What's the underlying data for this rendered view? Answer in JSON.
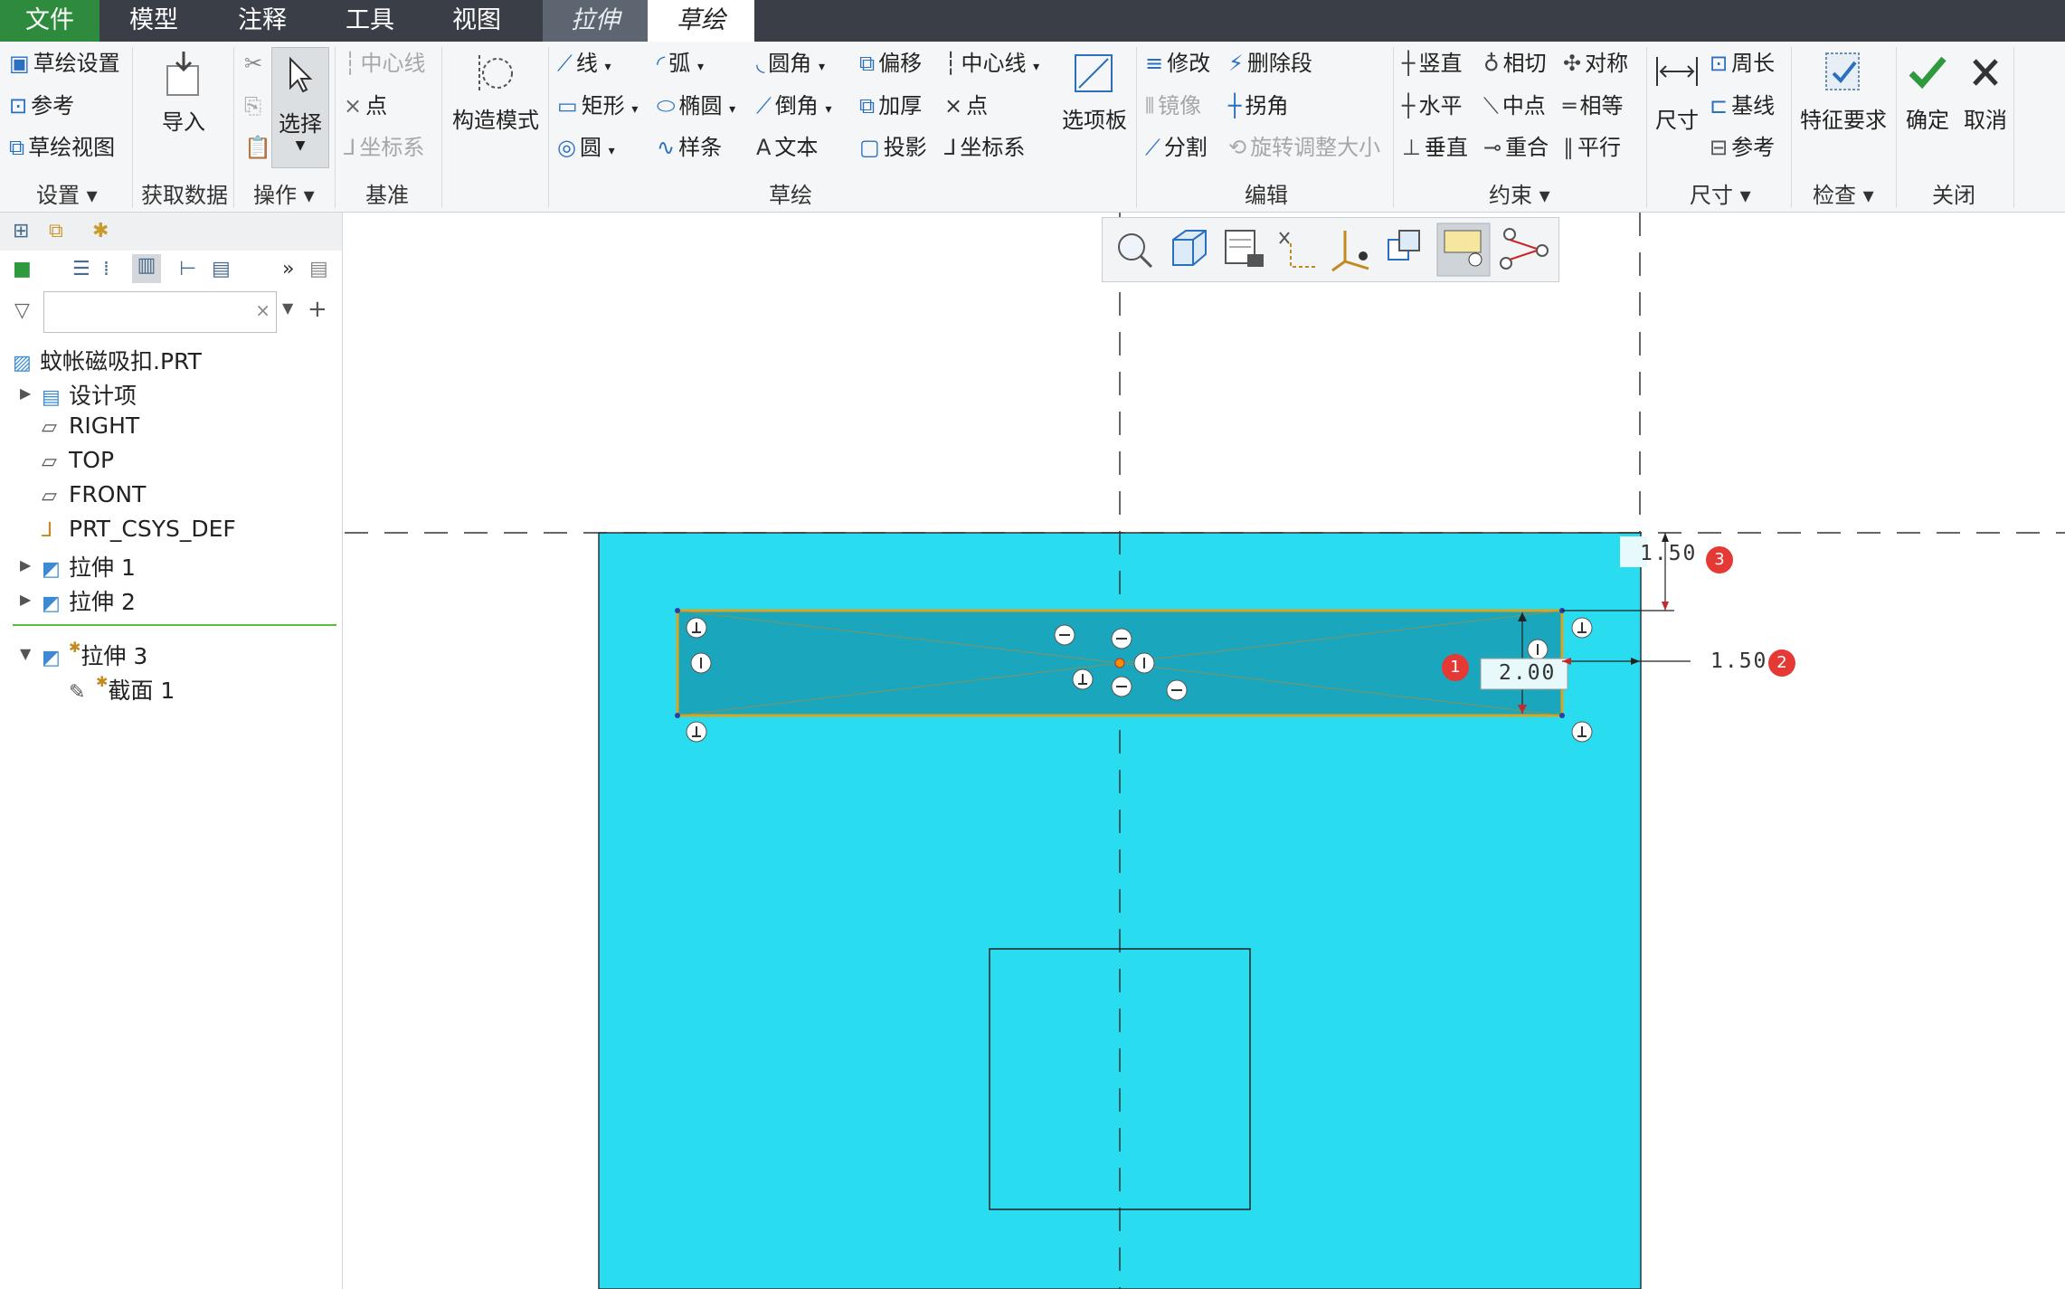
{
  "menubar": {
    "tabs": [
      "文件",
      "模型",
      "注释",
      "工具",
      "视图",
      "拉伸",
      "草绘"
    ]
  },
  "ribbon": {
    "settings": {
      "items": [
        "草绘设置",
        "参考",
        "草绘视图"
      ],
      "group": "设置"
    },
    "getdata": {
      "import": "导入",
      "group": "获取数据"
    },
    "operations": {
      "select": "选择",
      "group": "操作"
    },
    "datum": {
      "items": [
        "中心线",
        "点",
        "坐标系"
      ],
      "group": "基准"
    },
    "construct": "构造模式",
    "sketch": {
      "col1": [
        "线",
        "矩形",
        "圆"
      ],
      "col2": [
        "弧",
        "椭圆",
        "样条"
      ],
      "col3": [
        "圆角",
        "倒角",
        "文本"
      ],
      "col4": [
        "偏移",
        "加厚",
        "投影"
      ],
      "col5": [
        "中心线",
        "点",
        "坐标系"
      ],
      "palette": "选项板",
      "group": "草绘"
    },
    "edit": {
      "col1": [
        "修改",
        "镜像",
        "分割"
      ],
      "col2": [
        "删除段",
        "拐角",
        "旋转调整大小"
      ],
      "group": "编辑"
    },
    "constrain": {
      "col1": [
        "竖直",
        "水平",
        "垂直"
      ],
      "col2": [
        "相切",
        "中点",
        "重合"
      ],
      "col3": [
        "对称",
        "相等",
        "平行"
      ],
      "group": "约束"
    },
    "dimension": {
      "dim": "尺寸",
      "items": [
        "周长",
        "基线",
        "参考"
      ],
      "group": "尺寸"
    },
    "inspect": {
      "feature": "特征要求",
      "group": "检查"
    },
    "close": {
      "ok": "确定",
      "cancel": "取消",
      "group": "关闭"
    }
  },
  "tree": {
    "root": "蚊帐磁吸扣.PRT",
    "items": [
      "设计项",
      "RIGHT",
      "TOP",
      "FRONT",
      "PRT_CSYS_DEF",
      "拉伸 1",
      "拉伸 2"
    ],
    "active": "拉伸 3",
    "child": "截面 1"
  },
  "canvas": {
    "dim_height": "2.00",
    "dim_right": "1.50",
    "dim_top": "1.50",
    "badges": [
      "1",
      "2",
      "3"
    ]
  },
  "colors": {
    "part": "#29dcf0",
    "rect_fill": "#1aa6bd",
    "rect_edge": "#d9a520",
    "accent": "#2e8b3d"
  }
}
